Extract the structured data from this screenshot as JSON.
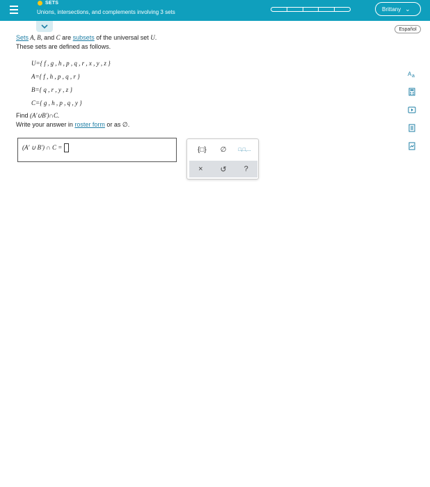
{
  "header": {
    "topic": "SETS",
    "title": "Unions, intersections, and complements involving 3 sets",
    "user_name": "Brittany",
    "progress_segments": 5,
    "progress_filled": 0,
    "colors": {
      "bar": "#0f9fbd",
      "dot": "#f5c518"
    }
  },
  "language_button": "Español",
  "problem": {
    "intro_link_sets": "Sets",
    "intro_vars": " A, B, ",
    "intro_and": "and ",
    "intro_c": "C",
    "intro_are": " are ",
    "intro_link_subsets": "subsets",
    "intro_of": " of the universal set ",
    "intro_u": "U",
    "intro_period": ".",
    "defined_line": "These sets are defined as follows.",
    "sets": [
      "U={ f , g , h , p , q , r , x , y , z }",
      "A={ f , h , p , q , r }",
      "B={ q , r , y , z }",
      "C={ g , h , p , q , y }"
    ],
    "find_prefix": "Find ",
    "find_expr": "(A′∪B′)∩C.",
    "write_prefix": "Write your answer in ",
    "write_link": "roster form",
    "write_suffix": " or as ∅."
  },
  "answer": {
    "expression": "(A′ ∪ B′) ∩ C ="
  },
  "tools": {
    "braces_icon": "{□}",
    "empty_set_icon": "∅",
    "list_icon": "□,□,...",
    "clear_icon": "×",
    "undo_icon": "↺",
    "help_icon": "?"
  },
  "side_icons": [
    "translate-icon",
    "calculator-icon",
    "video-icon",
    "textbook-icon",
    "notes-icon"
  ]
}
